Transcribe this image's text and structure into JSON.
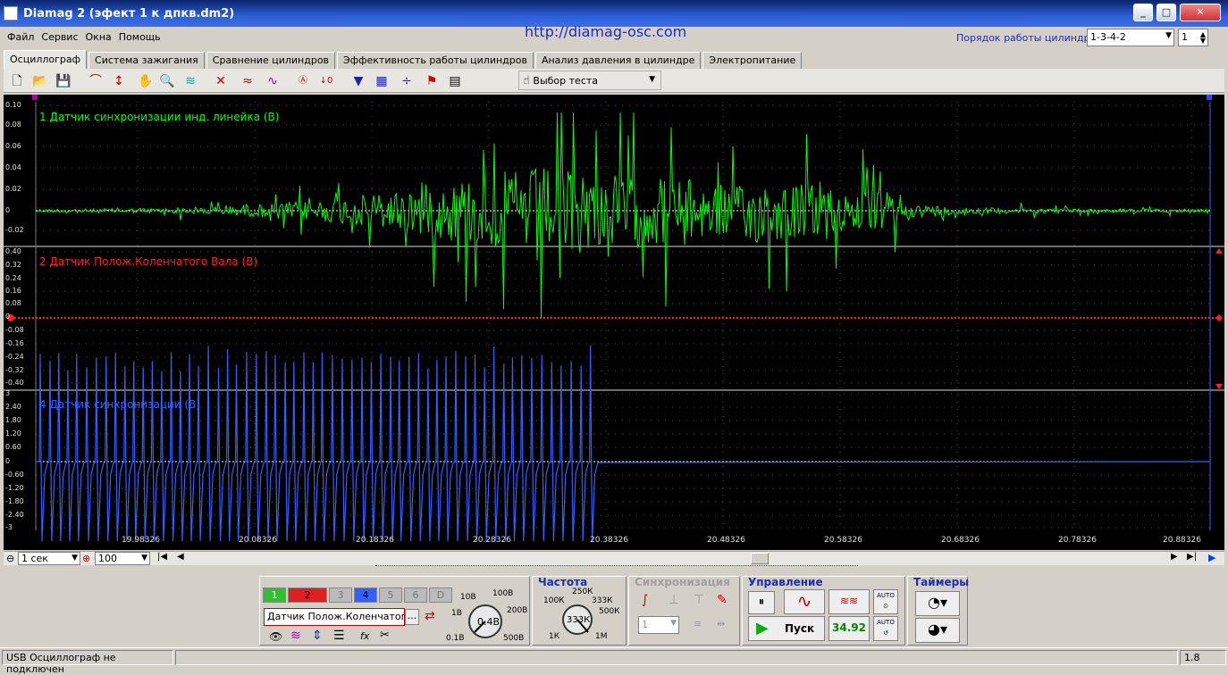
{
  "window": {
    "title": "Diamag 2 (эфект 1 к дпкв.dm2)",
    "min": "_",
    "max": "□",
    "close": "✕"
  },
  "menu": [
    "Файл",
    "Сервис",
    "Окна",
    "Помощь"
  ],
  "url": "http://diamag-osc.com",
  "order": {
    "label": "Порядок работы цилиндров",
    "value": "1-3-4-2",
    "cyl": "1"
  },
  "tabs": [
    "Осциллограф",
    "Система зажигания",
    "Сравнение цилиндров",
    "Эффективность работы цилиндров",
    "Анализ давления в цилиндре",
    "Электропитание"
  ],
  "toolbar": {
    "test_select": "Выбор теста"
  },
  "scope": {
    "ch1": {
      "label": "1 Датчик синхронизации инд. линейка (В)",
      "color": "#00ff00",
      "ticks": [
        "0.10",
        "0.08",
        "0.06",
        "0.04",
        "0.02",
        "0",
        "-0.02"
      ]
    },
    "ch2": {
      "label": "2 Датчик Полож.Коленчатого Вала (В)",
      "color": "#ff2020",
      "ticks": [
        "0.40",
        "0.32",
        "0.24",
        "0.16",
        "0.08",
        "0",
        "-0.08",
        "-0.16",
        "-0.24",
        "-0.32",
        "-0.40"
      ]
    },
    "ch4": {
      "label": "4 Датчик синхронизации (В)",
      "color": "#3060ff",
      "ticks": [
        "3",
        "2.40",
        "1.80",
        "1.20",
        "0.60",
        "0",
        "-0.60",
        "-1.20",
        "-1.80",
        "-2.40",
        "-3"
      ]
    },
    "x_ticks": [
      "19.98326",
      "20.08326",
      "20.18326",
      "20.28326",
      "20.38326",
      "20.48326",
      "20.58326",
      "20.68326",
      "20.78326",
      "20.88326"
    ]
  },
  "hscroll": {
    "time": "1 сек",
    "zoom": "100"
  },
  "channels": {
    "buttons": [
      "1",
      "2",
      "3",
      "4",
      "5",
      "6",
      "D"
    ],
    "selected": "Датчик Полож.Коленчатого В"
  },
  "voltage": {
    "value": "0.4В",
    "labels": [
      "10В",
      "100В",
      "1В",
      "200В",
      "0.1В",
      "500В"
    ]
  },
  "frequency": {
    "title": "Частота",
    "value": "333К",
    "labels": [
      "250К",
      "100К",
      "333К",
      "500К",
      "1К",
      "1М"
    ]
  },
  "sync": {
    "title": "Синхронизация",
    "value": "1"
  },
  "control": {
    "title": "Управление",
    "start": "Пуск",
    "rate": "34.92",
    "auto": "AUTO"
  },
  "timers": {
    "title": "Таймеры"
  },
  "status": {
    "left": "USB Осциллограф не подключен",
    "right": "1.8"
  }
}
